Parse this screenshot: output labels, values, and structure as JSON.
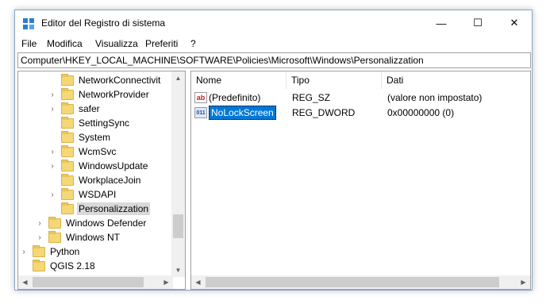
{
  "window": {
    "title": "Editor del Registro di sistema",
    "controls": {
      "minimize": "—",
      "maximize": "☐",
      "close": "✕"
    }
  },
  "menu": [
    "File",
    "Modifica",
    "Visualizza",
    "Preferiti",
    "?"
  ],
  "address": "Computer\\HKEY_LOCAL_MACHINE\\SOFTWARE\\Policies\\Microsoft\\Windows\\Personalizzation",
  "tree": [
    {
      "label": "NetworkConnectivit",
      "expandable": false,
      "level": 2
    },
    {
      "label": "NetworkProvider",
      "expandable": true,
      "level": 2
    },
    {
      "label": "safer",
      "expandable": true,
      "level": 2
    },
    {
      "label": "SettingSync",
      "expandable": false,
      "level": 2
    },
    {
      "label": "System",
      "expandable": false,
      "level": 2
    },
    {
      "label": "WcmSvc",
      "expandable": true,
      "level": 2
    },
    {
      "label": "WindowsUpdate",
      "expandable": true,
      "level": 2
    },
    {
      "label": "WorkplaceJoin",
      "expandable": false,
      "level": 2
    },
    {
      "label": "WSDAPI",
      "expandable": true,
      "level": 2
    },
    {
      "label": "Personalizzation",
      "expandable": false,
      "level": 2,
      "selected": true
    },
    {
      "label": "Windows Defender",
      "expandable": true,
      "level": 1
    },
    {
      "label": "Windows NT",
      "expandable": true,
      "level": 1
    },
    {
      "label": "Python",
      "expandable": true,
      "level": 0
    },
    {
      "label": "QGIS 2.18",
      "expandable": false,
      "level": 0
    }
  ],
  "columns": {
    "name": "Nome",
    "type": "Tipo",
    "data": "Dati"
  },
  "values": [
    {
      "icon": "string-value-icon",
      "icon_text": "ab",
      "name": "(Predefinito)",
      "type": "REG_SZ",
      "data": "(valore non impostato)"
    },
    {
      "icon": "dword-value-icon",
      "icon_text": "011",
      "name": "NoLockScreen",
      "type": "REG_DWORD",
      "data": "0x00000000 (0)",
      "selected": true
    }
  ]
}
